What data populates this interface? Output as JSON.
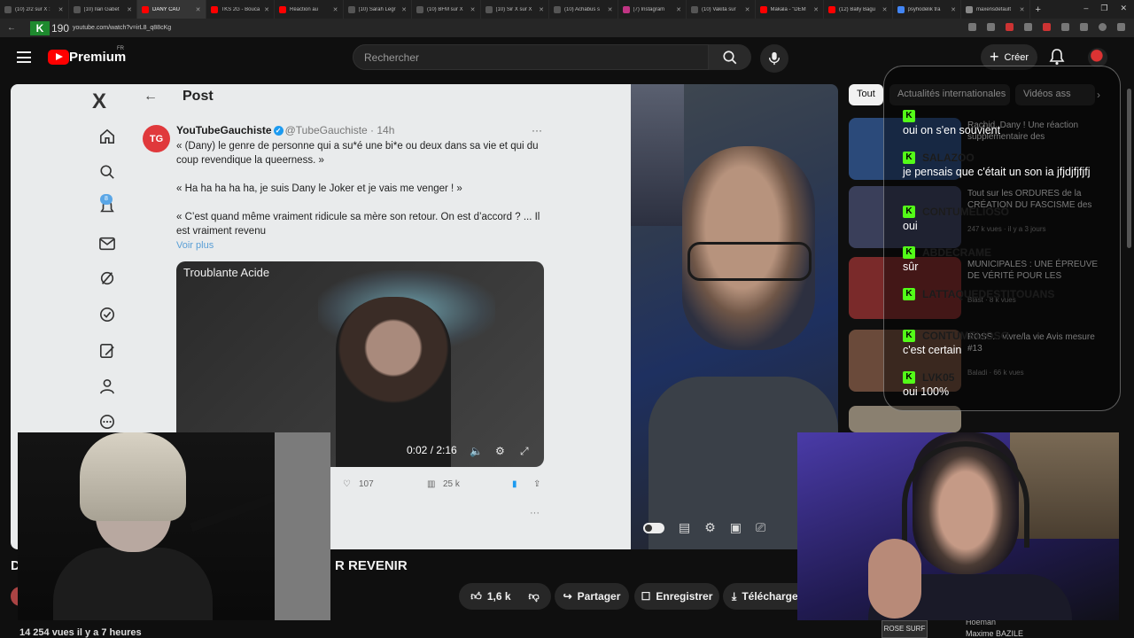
{
  "browser": {
    "tabs": [
      {
        "title": "(10) 2/2 sur X :",
        "icon": "x-icon",
        "color": "#555555",
        "active": false
      },
      {
        "title": "(10) Ilan Gabet",
        "icon": "x-icon",
        "color": "#555555",
        "active": false
      },
      {
        "title": "DANY CAU",
        "icon": "youtube-icon",
        "color": "#ff0000",
        "active": true
      },
      {
        "title": "TKS 2G - Bouca",
        "icon": "youtube-icon",
        "color": "#ff0000",
        "active": false
      },
      {
        "title": "Réaction au",
        "icon": "youtube-icon",
        "color": "#ff0000",
        "active": false
      },
      {
        "title": "(10) Sarah Legr",
        "icon": "x-icon",
        "color": "#555555",
        "active": false
      },
      {
        "title": "(10) BFM sur X",
        "icon": "x-icon",
        "color": "#555555",
        "active": false
      },
      {
        "title": "(10) Sir X sur X",
        "icon": "x-icon",
        "color": "#555555",
        "active": false
      },
      {
        "title": "(10) Achabus s",
        "icon": "x-icon",
        "color": "#555555",
        "active": false
      },
      {
        "title": "(7) Instagram",
        "icon": "instagram-icon",
        "color": "#c13584",
        "active": false
      },
      {
        "title": "(10) Vakita sur",
        "icon": "x-icon",
        "color": "#555555",
        "active": false
      },
      {
        "title": "Makala - \"DEM",
        "icon": "youtube-icon",
        "color": "#ff0000",
        "active": false
      },
      {
        "title": "(12) Bally Bagu",
        "icon": "youtube-icon",
        "color": "#ff0000",
        "active": false
      },
      {
        "title": "psyhodelik tra",
        "icon": "google-icon",
        "color": "#4285f4",
        "active": false
      },
      {
        "title": "maxensdefault",
        "icon": "globe-icon",
        "color": "#888888",
        "active": false
      }
    ],
    "new_tab": "+",
    "kick_badge": "K",
    "kick_count": "190",
    "url": "youtube.com/watch?v=irL8_q88cKg"
  },
  "youtube": {
    "logo_text": "Premium",
    "region": "FR",
    "search_placeholder": "Rechercher",
    "create_label": "Créer",
    "create_plus": "+"
  },
  "x_post": {
    "logo": "X",
    "back": "←",
    "header": "Post",
    "notif_count": "8",
    "avatar_text": "TG",
    "author": "YouTubeGauchiste",
    "verified": "✓",
    "handle": "@TubeGauchiste · 14h",
    "more": "···",
    "lines": [
      "« (Dany) le genre de personne qui a su*é une bi*e ou deux dans sa vie et qui du coup revendique la queerness. »",
      "« Ha ha ha ha ha, je suis Dany le Joker et je vais me venger ! »",
      "« C’est quand même vraiment ridicule sa mère son retour. On est d’accord ? ... Il est vraiment revenu"
    ],
    "see_more": "Voir plus",
    "embed_channel": "Troublante Acide",
    "embed_time": "0:02 / 2:16",
    "likes": "107",
    "views": "25 k",
    "faint_more": "···"
  },
  "video": {
    "title_start": "D",
    "title_end": "R REVENIR",
    "likes": "1,6 k",
    "share": "Partager",
    "save": "Enregistrer",
    "download": "Télécharger",
    "views_line": "14 254 vues  il y a 7 heures"
  },
  "sidebar": {
    "chips": [
      "Tout",
      "Actualités internationales",
      "Vidéos ass"
    ],
    "recs": [
      {
        "title": "Rachid, Dany ! Une réaction supplémentaire des",
        "meta": "",
        "color": "#2b4a7a"
      },
      {
        "title": "Tout sur les ORDURES de la CRÉATION DU FASCISME des",
        "meta": "247 k vues · il y a 3 jours",
        "color": "#3a3f5a"
      },
      {
        "title": "MUNICIPALES : UNE ÉPREUVE DE VÉRITÉ POUR LES",
        "meta": "Blast · 8 k vues",
        "color": "#7a2a2a"
      },
      {
        "title": "ROSS... vivre/la vie  Avis mesure #13",
        "meta": "Baladi · 66 k vues",
        "color": "#6a4a3a"
      }
    ],
    "author_channel": "Hoeman",
    "author_name": "Maxime BAZILE"
  },
  "chat": {
    "messages": [
      {
        "user": "",
        "text": "oui on s'en souvient"
      },
      {
        "user": "SALAZOO",
        "text": "je pensais que c'était un son ia jfjdjfjfjfj"
      },
      {
        "user": "CONTUMELIOSO",
        "text": "oui"
      },
      {
        "user": "ABDECRAME",
        "text": "sûr"
      },
      {
        "user": "LATTAQUEDESTITOUANS",
        "text": ""
      },
      {
        "user": "CONTUMELIOSO",
        "text": "c'est certain"
      },
      {
        "user": "LVK05",
        "text": "oui 100%"
      }
    ]
  },
  "overlay": {
    "badge": "ROSE SURF"
  },
  "colors": {
    "kick_green": "#53fc18",
    "youtube_red": "#ff0000",
    "x_blue": "#1d9bf0"
  }
}
